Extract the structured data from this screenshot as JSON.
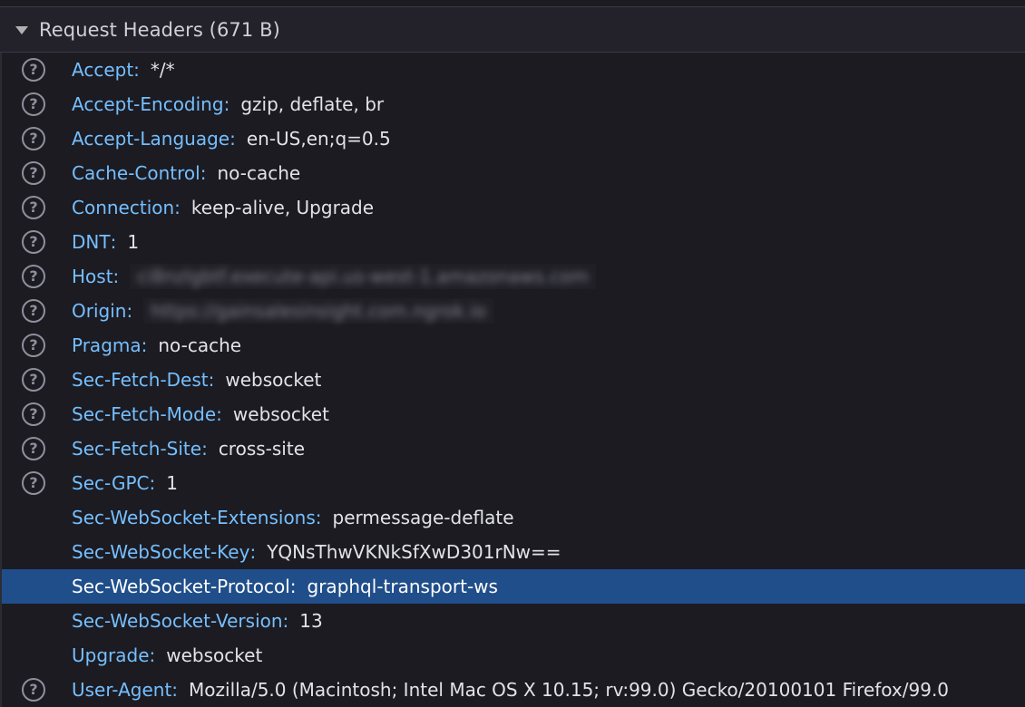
{
  "section": {
    "title": "Request Headers (671 B)"
  },
  "headers": [
    {
      "name": "Accept",
      "value": "*/*",
      "help": true
    },
    {
      "name": "Accept-Encoding",
      "value": "gzip, deflate, br",
      "help": true
    },
    {
      "name": "Accept-Language",
      "value": "en-US,en;q=0.5",
      "help": true
    },
    {
      "name": "Cache-Control",
      "value": "no-cache",
      "help": true
    },
    {
      "name": "Connection",
      "value": "keep-alive, Upgrade",
      "help": true
    },
    {
      "name": "DNT",
      "value": "1",
      "help": true
    },
    {
      "name": "Host",
      "value": "ci8nzlgbtf.execute-api.us-west-1.amazonaws.com",
      "help": true,
      "blurred": true
    },
    {
      "name": "Origin",
      "value": "https://gainsalesinsight.com.ngrok.io",
      "help": true,
      "blurred": true
    },
    {
      "name": "Pragma",
      "value": "no-cache",
      "help": true
    },
    {
      "name": "Sec-Fetch-Dest",
      "value": "websocket",
      "help": true
    },
    {
      "name": "Sec-Fetch-Mode",
      "value": "websocket",
      "help": true
    },
    {
      "name": "Sec-Fetch-Site",
      "value": "cross-site",
      "help": true
    },
    {
      "name": "Sec-GPC",
      "value": "1",
      "help": true
    },
    {
      "name": "Sec-WebSocket-Extensions",
      "value": "permessage-deflate",
      "help": false
    },
    {
      "name": "Sec-WebSocket-Key",
      "value": "YQNsThwVKNkSfXwD301rNw==",
      "help": false
    },
    {
      "name": "Sec-WebSocket-Protocol",
      "value": "graphql-transport-ws",
      "help": false,
      "selected": true
    },
    {
      "name": "Sec-WebSocket-Version",
      "value": "13",
      "help": false
    },
    {
      "name": "Upgrade",
      "value": "websocket",
      "help": false
    },
    {
      "name": "User-Agent",
      "value": "Mozilla/5.0 (Macintosh; Intel Mac OS X 10.15; rv:99.0) Gecko/20100101 Firefox/99.0",
      "help": true
    }
  ],
  "separator": ":",
  "help_glyph": "?",
  "icons": {
    "twisty": "chevron-down-icon",
    "help": "question-circle-icon"
  },
  "colors": {
    "header_name": "#75bfff",
    "selected_row": "#204e8a",
    "background": "#1c1b22"
  }
}
